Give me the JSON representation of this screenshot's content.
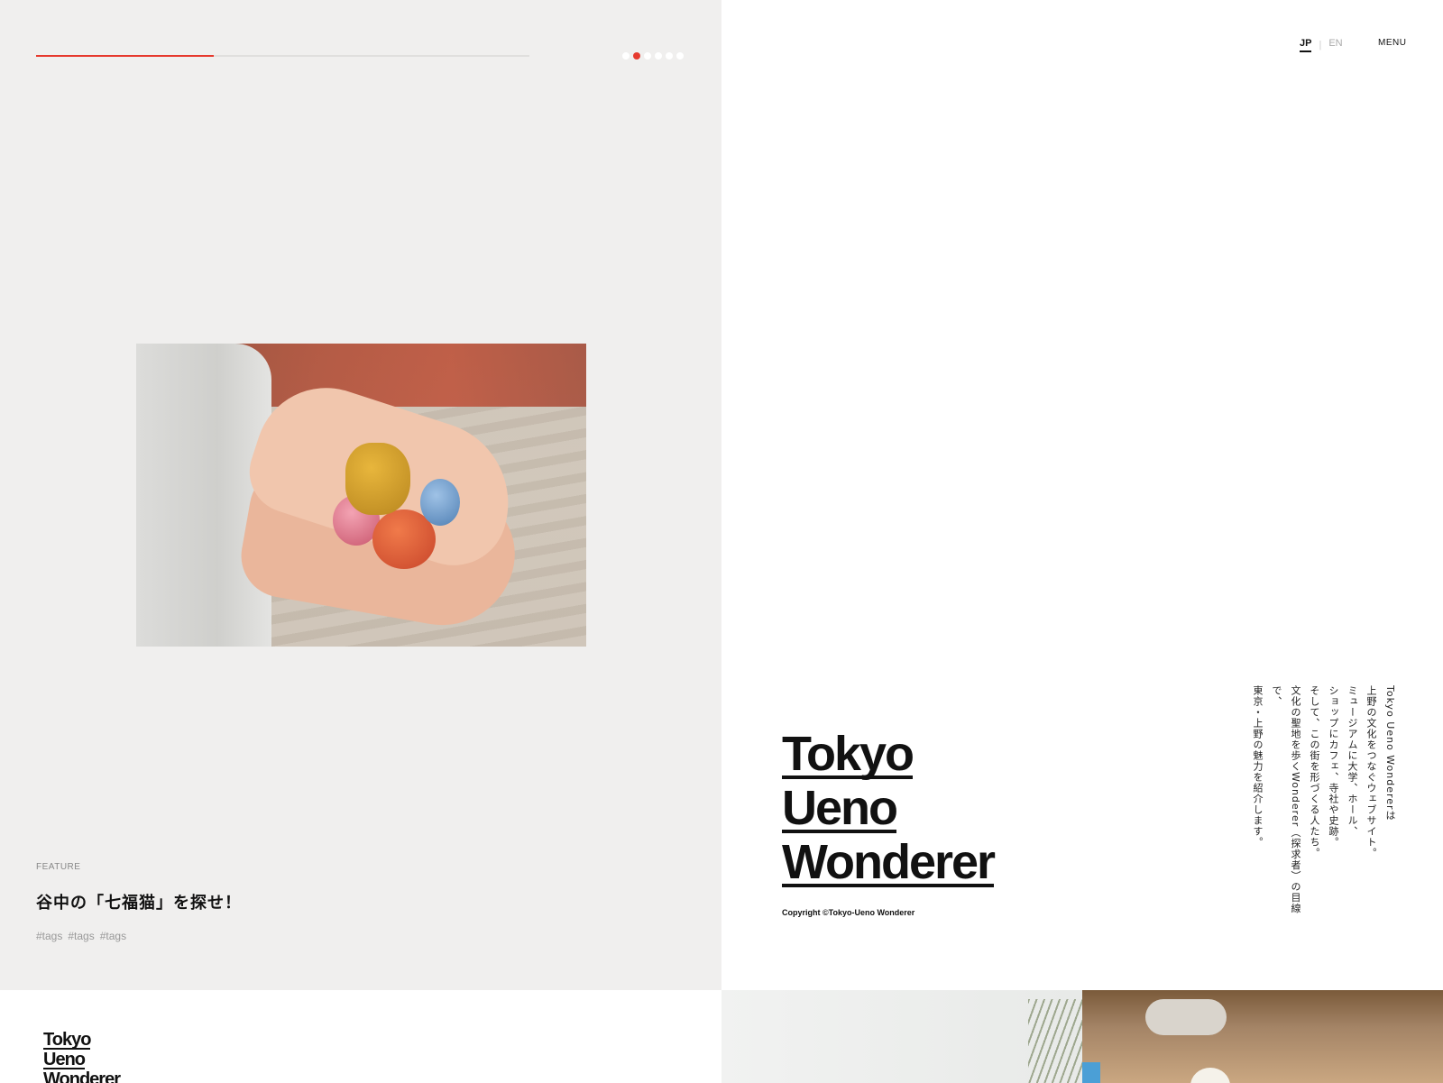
{
  "slider": {
    "progress": 0.36,
    "dots_total": 6,
    "active_index": 1
  },
  "feature": {
    "category": "FEATURE",
    "title": "谷中の「七福猫」を探せ！",
    "tags": [
      "#tags",
      "#tags",
      "#tags"
    ]
  },
  "header": {
    "lang_jp": "JP",
    "lang_en": "EN",
    "menu": "MENU"
  },
  "brand": {
    "line1": "Tokyo",
    "line2": "Ueno",
    "line3": "Wonderer",
    "copyright": "Copyright ©Tokyo-Ueno Wonderer"
  },
  "intro": {
    "lines": [
      "Tokyo Ueno Wondererは",
      "上野の文化をつなぐウェブサイト。",
      "ミュージアムに大学、ホール、",
      "ショップにカフェ、寺社や史跡。",
      "そして、この街を形づくる人たち。",
      "文化の聖地を歩くWonderer（探求者）の目線で、",
      "東京・上野の魅力を紹介します。"
    ]
  },
  "colors": {
    "accent": "#e63a2e",
    "panel_bg": "#f0efee"
  },
  "icons": {
    "feature_image": "hands-holding-cloth-balls-photo",
    "bottom_image": "cafe-interior-photo"
  }
}
